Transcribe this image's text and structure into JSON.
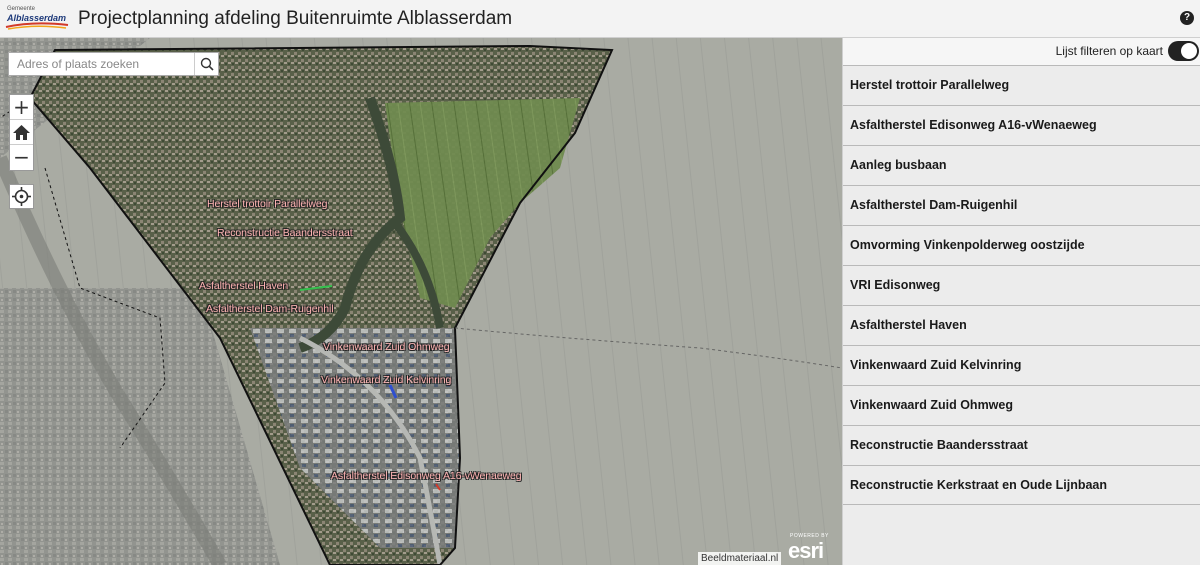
{
  "header": {
    "logo_top": "Gemeente",
    "logo_main": "Alblasserdam",
    "title": "Projectplanning afdeling Buitenruimte Alblasserdam",
    "help_icon": "question-circle-icon"
  },
  "map": {
    "search": {
      "placeholder": "Adres of plaats zoeken",
      "value": "",
      "icon": "search-icon"
    },
    "zoom_in": "+",
    "zoom_out": "−",
    "home_icon": "home-icon",
    "locate_icon": "crosshair-icon",
    "labels": [
      "Herstel trottoir Parallelweg",
      "Reconstructie Baandersstraat",
      "Asfaltherstel Haven",
      "Asfaltherstel Dam-Ruigenhil",
      "Vinkenwaard Zuid Ohmweg",
      "Vinkenwaard Zuid Kelvinring",
      "Asfaltherstel Edisonweg A16-vWenaeweg"
    ],
    "label_color": "#ffb3b3",
    "attribution": "Beeldmateriaal.nl",
    "esri_powered": "POWERED BY",
    "esri_logo": "esri"
  },
  "panel": {
    "filter_label": "Lijst filteren op kaart",
    "filter_on": true,
    "projects": [
      "Herstel trottoir Parallelweg",
      "Asfaltherstel Edisonweg A16-vWenaeweg",
      "Aanleg busbaan",
      "Asfaltherstel Dam-Ruigenhil",
      "Omvorming Vinkenpolderweg oostzijde",
      "VRI Edisonweg",
      "Asfaltherstel Haven",
      "Vinkenwaard Zuid Kelvinring",
      "Vinkenwaard Zuid Ohmweg",
      "Reconstructie Baandersstraat",
      "Reconstructie Kerkstraat en Oude Lijnbaan"
    ]
  }
}
